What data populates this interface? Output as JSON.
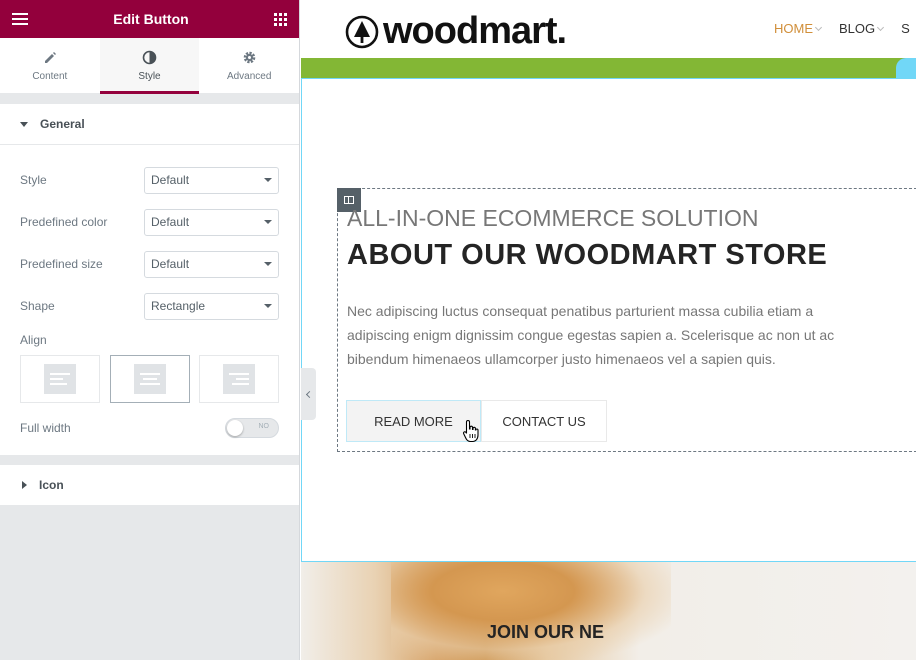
{
  "panel": {
    "title": "Edit Button",
    "tabs": [
      {
        "label": "Content",
        "icon": "pencil-icon"
      },
      {
        "label": "Style",
        "icon": "contrast-icon"
      },
      {
        "label": "Advanced",
        "icon": "gear-icon"
      }
    ],
    "general": {
      "heading": "General",
      "controls": [
        {
          "label": "Style",
          "value": "Default"
        },
        {
          "label": "Predefined color",
          "value": "Default"
        },
        {
          "label": "Predefined size",
          "value": "Default"
        },
        {
          "label": "Shape",
          "value": "Rectangle"
        }
      ],
      "align_label": "Align",
      "align_options": [
        "left",
        "center",
        "right"
      ],
      "align_selected": "center",
      "full_width_label": "Full width",
      "full_width_toggle": "NO"
    },
    "icon_section": "Icon",
    "accent_color": "#93003c"
  },
  "site": {
    "logo": "woodmart.",
    "nav": [
      {
        "label": "HOME",
        "active": true
      },
      {
        "label": "BLOG",
        "active": false
      },
      {
        "label": "S",
        "active": false
      }
    ],
    "green": "#83b735",
    "subtitle": "ALL-IN-ONE ECOMMERCE SOLUTION",
    "title": "ABOUT OUR WOODMART STORE",
    "paragraph": "Nec  adipiscing luctus consequat penatibus parturient massa cubilia etiam a adipiscing enigm dignissim congue egestas sapien a. Scelerisque ac non ut ac bibendum himenaeos ullamcorper justo himenaeos vel a sapien quis.",
    "buttons": [
      "READ MORE",
      "CONTACT US"
    ],
    "join_title": "JOIN OUR NE"
  }
}
